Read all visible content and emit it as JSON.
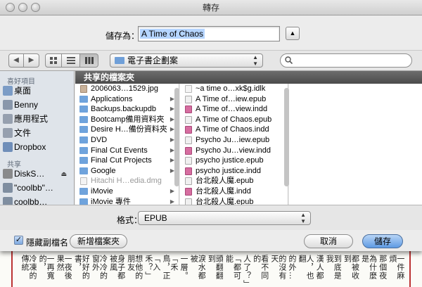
{
  "window": {
    "title": "轉存"
  },
  "save_as": {
    "label": "儲存為：",
    "value": "A Time of Chaos"
  },
  "toolbar": {
    "back_label": "◀",
    "forward_label": "▶",
    "location": "電子書企劃案",
    "search_placeholder": ""
  },
  "sidebar": {
    "sections": [
      {
        "header": "喜好項目",
        "items": [
          {
            "label": "桌面",
            "icon": "desktop-icon"
          },
          {
            "label": "Benny",
            "icon": "home-icon"
          },
          {
            "label": "應用程式",
            "icon": "applications-icon"
          },
          {
            "label": "文件",
            "icon": "documents-icon"
          },
          {
            "label": "Dropbox",
            "icon": "dropbox-icon"
          }
        ]
      },
      {
        "header": "共享",
        "items": [
          {
            "label": "DiskS…",
            "icon": "server-icon"
          },
          {
            "label": "\"coolbb\"…",
            "icon": "computer-icon"
          },
          {
            "label": "coolbb…",
            "icon": "computer-icon"
          }
        ]
      }
    ]
  },
  "path_header": "共享的檔案夾",
  "column1": [
    {
      "name": "2006063…1529.jpg",
      "type": "img",
      "dim": false,
      "folder": false
    },
    {
      "name": "Applications",
      "type": "folder",
      "dim": false,
      "folder": true
    },
    {
      "name": "Backups.backupdb",
      "type": "folder",
      "dim": false,
      "folder": true
    },
    {
      "name": "Bootcamp備用資料夾",
      "type": "folder",
      "dim": false,
      "folder": true
    },
    {
      "name": "Desire H…備份資料夾",
      "type": "folder",
      "dim": false,
      "folder": true
    },
    {
      "name": "DVD",
      "type": "folder",
      "dim": false,
      "folder": true
    },
    {
      "name": "Final Cut Events",
      "type": "folder",
      "dim": false,
      "folder": true
    },
    {
      "name": "Final Cut Projects",
      "type": "folder",
      "dim": false,
      "folder": true
    },
    {
      "name": "Google",
      "type": "folder",
      "dim": false,
      "folder": true
    },
    {
      "name": "Hitachi H…edia.dmg",
      "type": "file",
      "dim": true,
      "folder": false
    },
    {
      "name": "iMovie",
      "type": "folder",
      "dim": false,
      "folder": true
    },
    {
      "name": "iMovie 專件",
      "type": "folder",
      "dim": false,
      "folder": true
    }
  ],
  "column2": [
    {
      "name": "~a time o…xk$g.idlk",
      "type": "file",
      "dim": false
    },
    {
      "name": "A Time of…iew.epub",
      "type": "epub",
      "dim": false
    },
    {
      "name": "A Time of…view.indd",
      "type": "indd",
      "dim": false
    },
    {
      "name": "A Time of Chaos.epub",
      "type": "epub",
      "dim": false
    },
    {
      "name": "A Time of Chaos.indd",
      "type": "indd",
      "dim": false
    },
    {
      "name": "Psycho Ju…iew.epub",
      "type": "epub",
      "dim": false
    },
    {
      "name": "Psycho Ju…view.indd",
      "type": "indd",
      "dim": false
    },
    {
      "name": "psycho justice.epub",
      "type": "epub",
      "dim": false
    },
    {
      "name": "psycho justice.indd",
      "type": "indd",
      "dim": false
    },
    {
      "name": "台北殺人魔.epub",
      "type": "epub",
      "dim": false
    },
    {
      "name": "台北殺人魔.indd",
      "type": "indd",
      "dim": false
    },
    {
      "name": "台北殺人魔.epub",
      "type": "epub",
      "dim": false
    }
  ],
  "format": {
    "label": "格式：",
    "value": "EPUB"
  },
  "bottom": {
    "hide_extension_label": "隱藏副檔名",
    "hide_extension_checked": true,
    "new_folder_label": "新增檔案夾",
    "cancel_label": "取消",
    "save_label": "儲存"
  },
  "background_doc": {
    "columns": [
      "冷凍的傳統",
      "一再寬的，",
      "一夜後果然",
      "好好的書，",
      "冷冷的窗外",
      "身子都被風",
      "想他的朋友",
      "「入禾？」",
      "「禾鳥，正",
      "一層。",
      "淚水都被",
      "頭翻翻到",
      "「都可能",
      "人了？」",
      "看不同的",
      "的沒有天",
      "的外…",
      "人，也翻",
      "漢人都",
      "到底是我",
      "都被收到",
      "為什麼是",
      "那個夜",
      "一件麻煩"
    ]
  }
}
